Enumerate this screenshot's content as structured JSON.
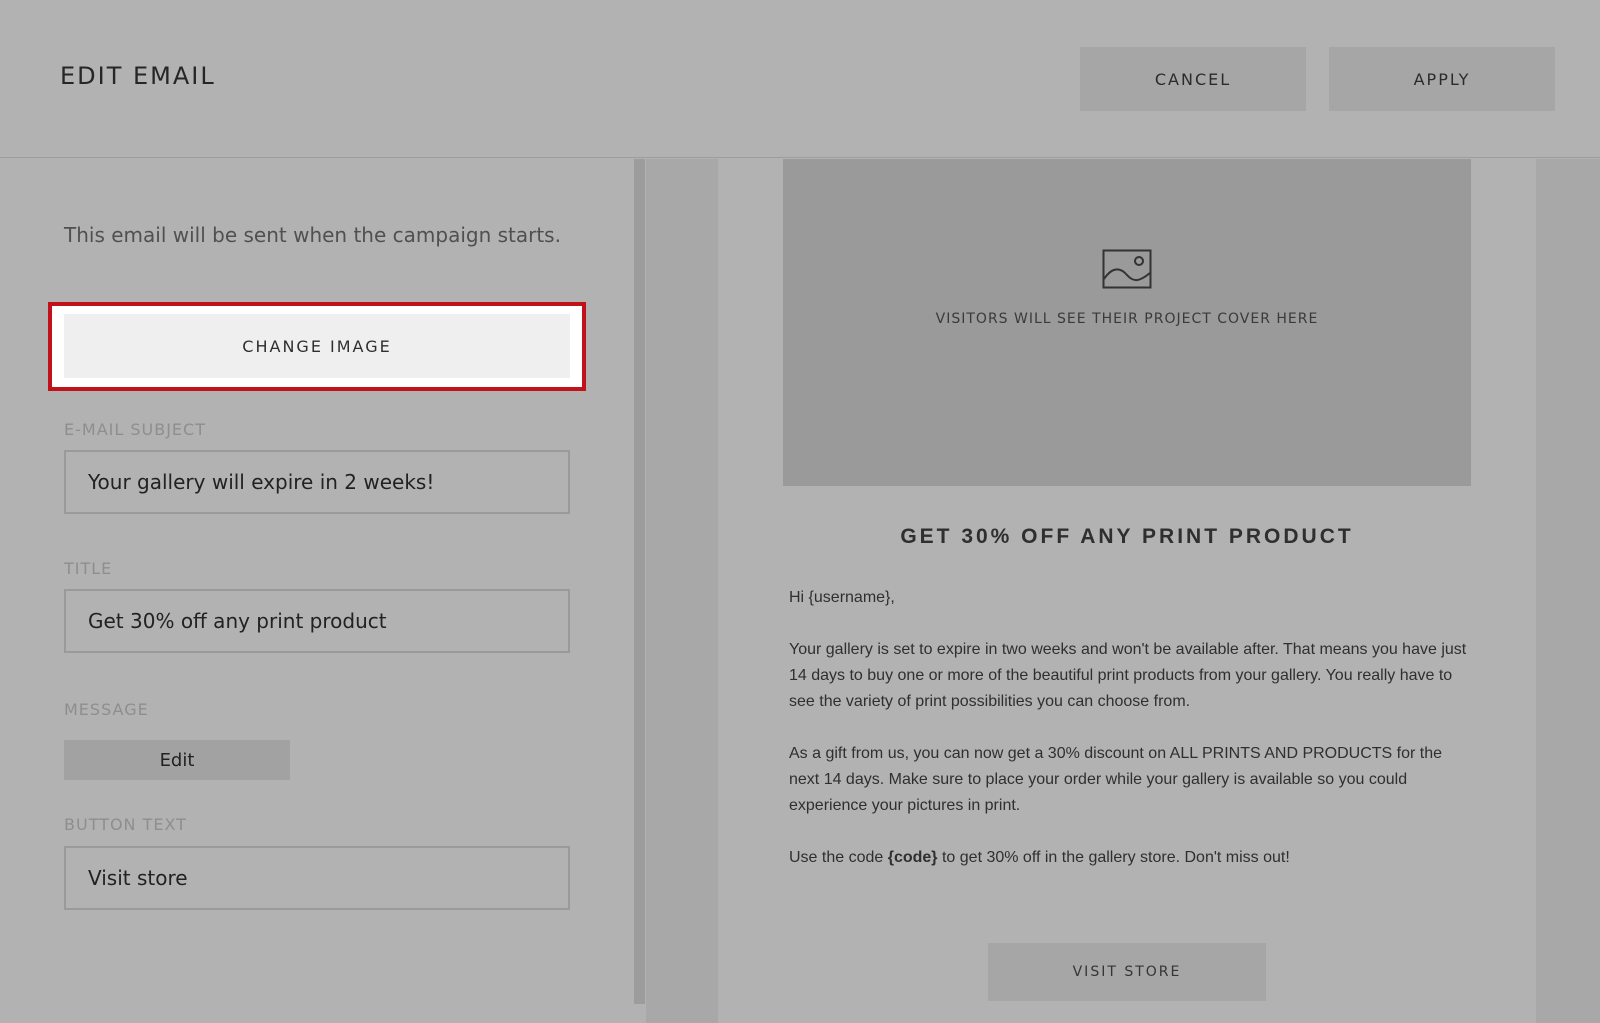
{
  "header": {
    "title": "EDIT EMAIL",
    "cancel_label": "CANCEL",
    "apply_label": "APPLY"
  },
  "form": {
    "intro": "This email will be sent when the campaign starts.",
    "change_image_label": "CHANGE IMAGE",
    "subject_label": "E-MAIL SUBJECT",
    "subject_value": "Your gallery will expire in 2 weeks!",
    "title_label": "TITLE",
    "title_value": "Get 30% off any print product",
    "message_label": "MESSAGE",
    "edit_label": "Edit",
    "button_text_label": "BUTTON TEXT",
    "button_text_value": "Visit store"
  },
  "preview": {
    "cover_icon": "image-placeholder-icon",
    "cover_text": "VISITORS WILL SEE THEIR PROJECT COVER HERE",
    "title": "GET 30% OFF ANY PRINT PRODUCT",
    "greeting": "Hi {username},",
    "paragraph1": "Your gallery is set to expire in two weeks and won't be available after. That means you have just 14 days to buy one or more of the beautiful print products from your gallery. You really have to see the variety of print possibilities you can choose from.",
    "paragraph2": "As a gift from us, you can now get a 30% discount on ALL PRINTS AND PRODUCTS for the next 14 days. Make sure to place your order while your gallery is available so you could experience your pictures in print.",
    "code_prefix": "Use the code ",
    "code": "{code}",
    "code_suffix": " to get 30% off in the gallery store. Don't miss out!",
    "button_label": "VISIT STORE"
  },
  "colors": {
    "highlight": "#c1121c",
    "overlay": "#b2b2b2"
  }
}
